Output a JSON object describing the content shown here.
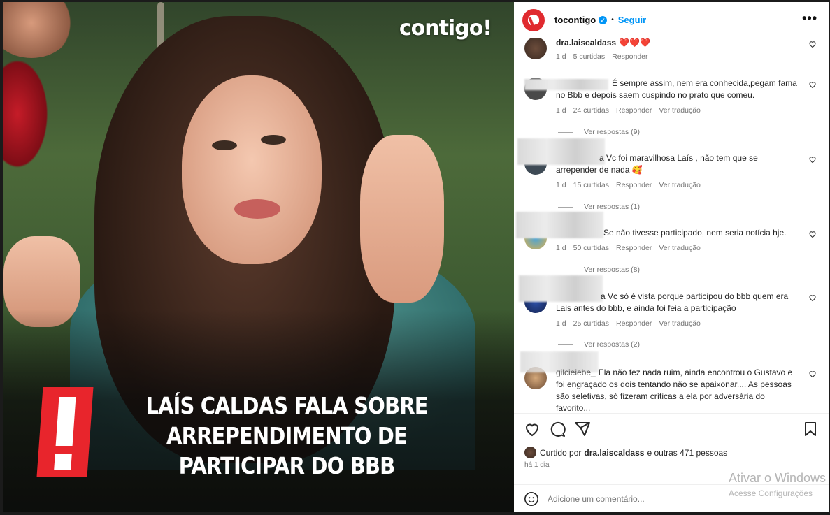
{
  "media": {
    "brand": "contigo!",
    "headline": "LAÍS CALDAS FALA SOBRE ARREPENDIMENTO DE PARTICIPAR DO BBB"
  },
  "header": {
    "account": "tocontigo",
    "separator": "•",
    "follow_label": "Seguir",
    "more_label": "•••"
  },
  "comments": [
    {
      "user": "dra.laiscaldass",
      "text": "❤️❤️❤️",
      "time": "1 d",
      "likes": "5 curtidas",
      "reply": "Responder",
      "translate": ""
    },
    {
      "user": "",
      "text": "É sempre assim, nem era conhecida,pegam fama no Bbb e depois saem cuspindo no prato que comeu.",
      "time": "1 d",
      "likes": "24 curtidas",
      "reply": "Responder",
      "translate": "Ver tradução"
    },
    {
      "user": "",
      "text": "a Vc foi maravilhosa Laís , não tem que se arrepender de nada 🥰",
      "time": "1 d",
      "likes": "15 curtidas",
      "reply": "Responder",
      "translate": "Ver tradução"
    },
    {
      "user": "",
      "text": "Se não tivesse participado, nem seria notícia hje.",
      "time": "1 d",
      "likes": "50 curtidas",
      "reply": "Responder",
      "translate": "Ver tradução"
    },
    {
      "user": "",
      "text": "a Vc só é vista porque participou do bbb quem era Lais antes do bbb, e ainda foi feia a participação",
      "time": "1 d",
      "likes": "25 curtidas",
      "reply": "Responder",
      "translate": "Ver tradução"
    },
    {
      "user": "gilcieiebe_",
      "text": "Ela não fez nada ruim, ainda encontrou o Gustavo e foi engraçado os dois tentando não se apaixonar.... As pessoas são seletivas, só fizeram críticas a ela por adversária do favorito...",
      "time": "",
      "likes": "",
      "reply": "",
      "translate": ""
    }
  ],
  "replies": [
    "Ver respostas (9)",
    "Ver respostas (1)",
    "Ver respostas (8)",
    "Ver respostas (2)"
  ],
  "likes_bar": {
    "prefix": "Curtido por",
    "user": "dra.laiscaldass",
    "suffix": "e outras 471 pessoas"
  },
  "time_ago": "há 1 dia",
  "add_comment_placeholder": "Adicione um comentário...",
  "watermark": {
    "line1": "Ativar o Windows",
    "line2": "Acesse Configurações"
  },
  "colors": {
    "brand_red": "#e8252c",
    "link_blue": "#0095f6",
    "muted": "#737373"
  }
}
